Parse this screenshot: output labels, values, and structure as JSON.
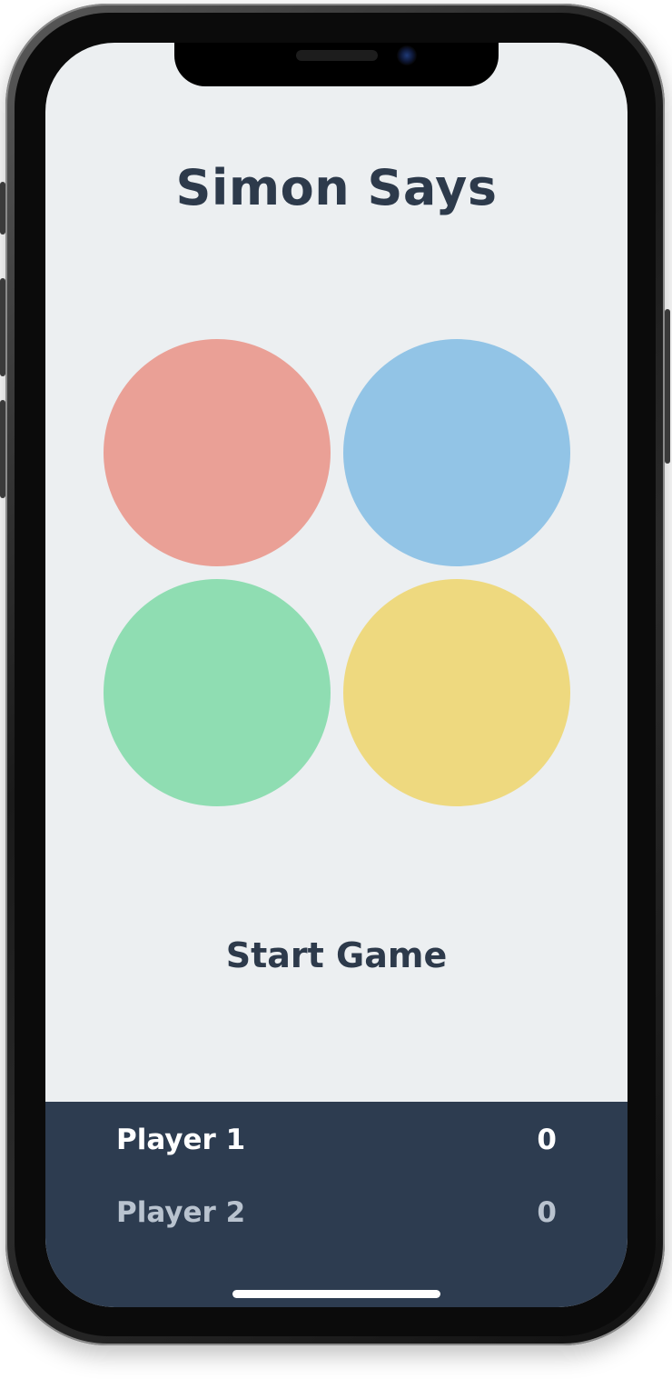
{
  "app": {
    "title": "Simon Says"
  },
  "pads": [
    {
      "name": "red",
      "color": "#eaa096"
    },
    {
      "name": "blue",
      "color": "#92c4e6"
    },
    {
      "name": "green",
      "color": "#8fddb2"
    },
    {
      "name": "yellow",
      "color": "#eed97f"
    }
  ],
  "controls": {
    "start_label": "Start Game"
  },
  "scoreboard": {
    "players": [
      {
        "name": "Player 1",
        "score": "0",
        "active": true
      },
      {
        "name": "Player 2",
        "score": "0",
        "active": false
      }
    ],
    "background": "#2d3c50"
  },
  "theme": {
    "background": "#eceff1",
    "text": "#2d3a4b"
  }
}
